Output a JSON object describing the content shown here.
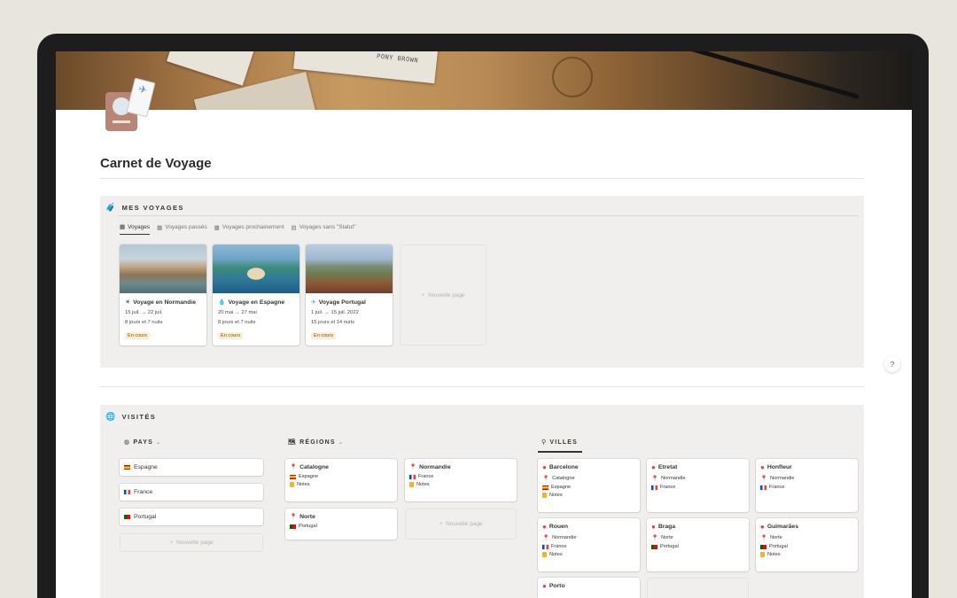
{
  "page": {
    "title": "Carnet de Voyage",
    "help_label": "?"
  },
  "cover": {
    "stamp_text": "PONY BROWN"
  },
  "voyages": {
    "heading": "MES VOYAGES",
    "tabs": [
      {
        "label": "Voyages",
        "active": true
      },
      {
        "label": "Voyages passés",
        "active": false
      },
      {
        "label": "Voyages prochainement",
        "active": false
      },
      {
        "label": "Voyages sans \"Statut\"",
        "active": false
      }
    ],
    "cards": [
      {
        "name": "Voyage en Normandie",
        "icon": "sun-icon",
        "dates": "15 juil. → 22 juil.",
        "duration": "8 jours et 7 nuits",
        "status": "En cours"
      },
      {
        "name": "Voyage en Espagne",
        "icon": "drop-icon",
        "dates": "20 mai → 27 mai",
        "duration": "8 jours et 7 nuits",
        "status": "En cours"
      },
      {
        "name": "Voyage Portugal",
        "icon": "plane-icon",
        "dates": "1 juil. → 15 juil. 2022",
        "duration": "15 jours et 14 nuits",
        "status": "En cours"
      }
    ],
    "new_page": "Nouvelle page"
  },
  "visites": {
    "heading": "VISITÉS",
    "pays": {
      "heading": "PAYS",
      "items": [
        "Espagne",
        "France",
        "Portugal"
      ],
      "new_page": "Nouvelle page"
    },
    "regions": {
      "heading": "RÉGIONS",
      "items": [
        {
          "name": "Catalogne",
          "country": "Espagne",
          "notes": "Notes"
        },
        {
          "name": "Normandie",
          "country": "France",
          "notes": "Notes"
        },
        {
          "name": "Norte",
          "country": "Portugal"
        }
      ],
      "new_page": "Nouvelle page"
    },
    "villes": {
      "heading": "VILLES",
      "items": [
        {
          "name": "Barcelone",
          "region": "Catalogne",
          "country": "Espagne",
          "notes": "Notes"
        },
        {
          "name": "Etretat",
          "region": "Normandie",
          "country": "France"
        },
        {
          "name": "Honfleur",
          "region": "Normandie",
          "country": "France"
        },
        {
          "name": "Rouen",
          "region": "Normandie",
          "country": "France",
          "notes": "Notes"
        },
        {
          "name": "Braga",
          "region": "Norte",
          "country": "Portugal"
        },
        {
          "name": "Guimarães",
          "region": "Norte",
          "country": "Portugal",
          "notes": "Notes"
        },
        {
          "name": "Porto"
        }
      ]
    }
  },
  "colors": {
    "status_bg": "#fbeed2",
    "pin": "#d83f63",
    "block_bg": "#f0efed"
  }
}
